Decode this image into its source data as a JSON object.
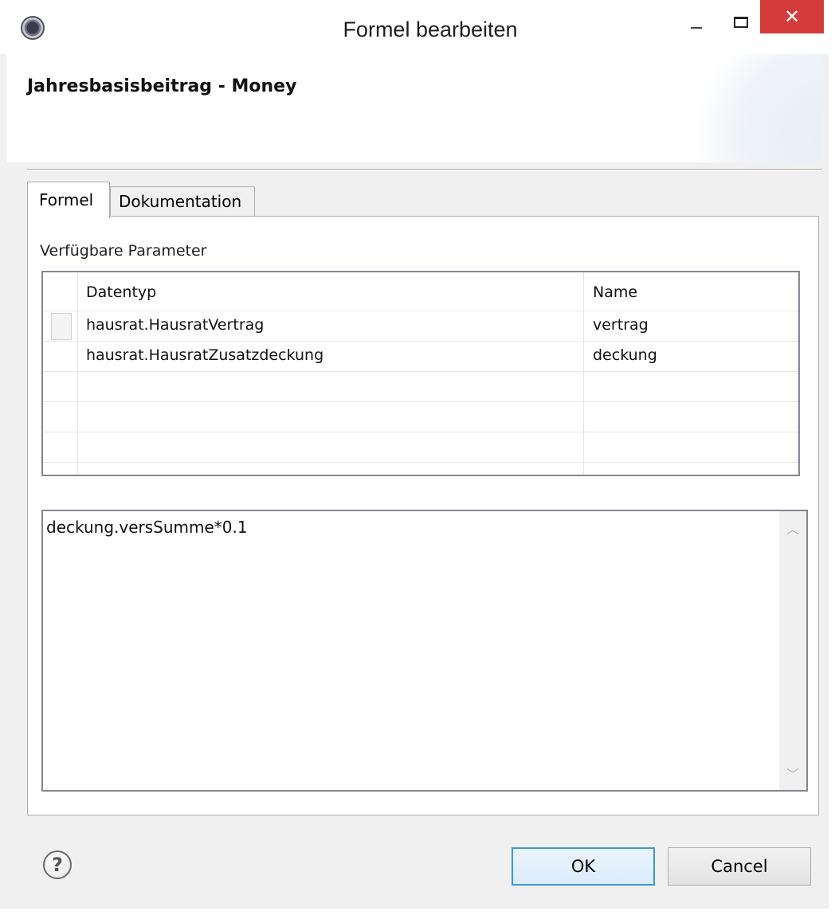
{
  "window": {
    "title": "Formel bearbeiten",
    "close_glyph": "✕",
    "icons": {
      "app": "eclipse-app-icon",
      "minimize": "minimize-icon",
      "maximize": "maximize-icon",
      "close": "close-icon"
    }
  },
  "header": {
    "title": "Jahresbasisbeitrag - Money"
  },
  "tabs": [
    {
      "label": "Formel",
      "selected": true
    },
    {
      "label": "Dokumentation",
      "selected": false
    }
  ],
  "parameters": {
    "label": "Verfügbare Parameter",
    "columns": [
      "Datentyp",
      "Name"
    ],
    "rows": [
      {
        "type": "hausrat.HausratVertrag",
        "name": "vertrag"
      },
      {
        "type": "hausrat.HausratZusatzdeckung",
        "name": "deckung"
      },
      {
        "type": "",
        "name": ""
      },
      {
        "type": "",
        "name": ""
      },
      {
        "type": "",
        "name": ""
      }
    ]
  },
  "editor": {
    "value": "deckung.versSumme*0.1",
    "scroll_up": "︿",
    "scroll_down": "﹀"
  },
  "footer": {
    "help_glyph": "?",
    "ok_label": "OK",
    "cancel_label": "Cancel"
  },
  "colors": {
    "close_button": "#d43c3c",
    "ok_border": "#3c96e0",
    "dialog_bg": "#f0f0f0"
  }
}
